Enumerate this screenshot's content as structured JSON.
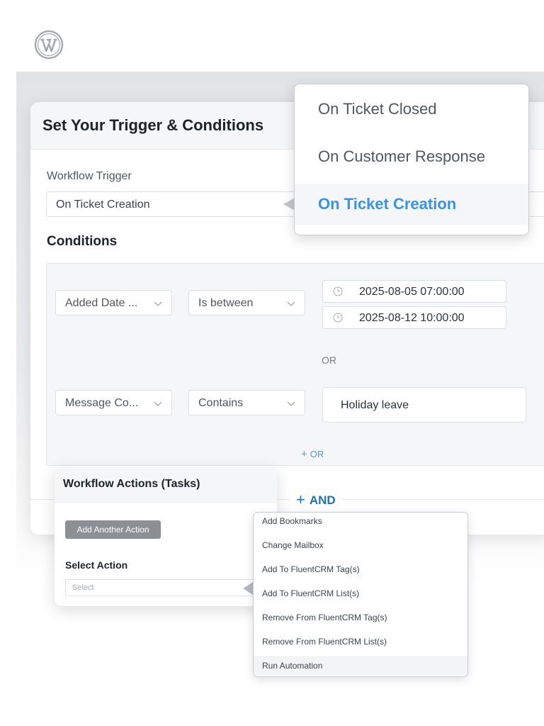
{
  "app": {
    "logo_icon": "wordpress-logo-icon"
  },
  "main_card": {
    "title": "Set Your Trigger & Conditions",
    "trigger_label": "Workflow Trigger",
    "trigger_value": "On Ticket Creation",
    "conditions_title": "Conditions"
  },
  "conditions": {
    "row1": {
      "field": "Added Date ...",
      "operator": "Is between",
      "start_date": "2025-08-05 07:00:00",
      "end_date": "2025-08-12 10:00:00"
    },
    "or_separator": "OR",
    "row2": {
      "field": "Message Co...",
      "operator": "Contains",
      "value": "Holiday leave"
    },
    "add_or_label": "OR",
    "add_and_label": "AND"
  },
  "trigger_dropdown": {
    "options": [
      {
        "label": "On Ticket Closed",
        "selected": false
      },
      {
        "label": "On Customer Response",
        "selected": false
      },
      {
        "label": "On Ticket Creation",
        "selected": true
      }
    ]
  },
  "actions_card": {
    "title": "Workflow Actions (Tasks)",
    "add_button_label": "Add Another Action",
    "select_label": "Select Action",
    "select_placeholder": "Select"
  },
  "action_dropdown": {
    "options": [
      "Add Bookmarks",
      "Change Mailbox",
      "Add To FluentCRM Tag(s)",
      "Add To FluentCRM List(s)",
      "Remove From FluentCRM Tag(s)",
      "Remove From FluentCRM List(s)",
      "Run Automation"
    ],
    "highlighted": "Run Automation"
  },
  "colors": {
    "accent_blue": "#2271b1",
    "dropdown_active": "#3b93e8",
    "muted_button": "#8c8f94"
  }
}
